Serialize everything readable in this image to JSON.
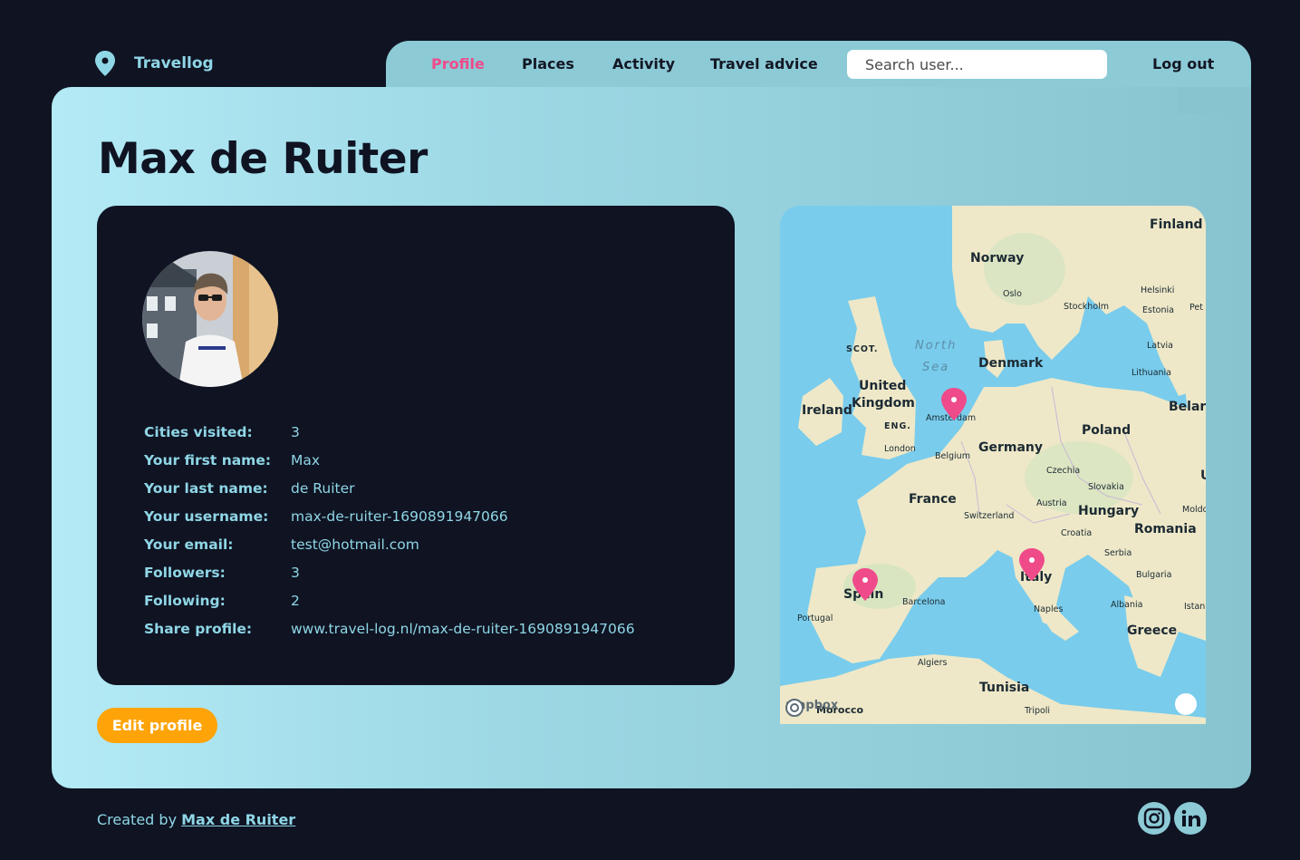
{
  "brand": {
    "name": "Travellog",
    "icon": "map-pin-icon"
  },
  "nav": {
    "items": [
      {
        "label": "Profile",
        "active": true
      },
      {
        "label": "Places",
        "active": false
      },
      {
        "label": "Activity",
        "active": false
      },
      {
        "label": "Travel advice",
        "active": false
      }
    ],
    "search_placeholder": "Search user...",
    "logout": "Log out"
  },
  "profile": {
    "name": "Max de Ruiter",
    "fields": [
      {
        "label": "Cities visited:",
        "value": "3"
      },
      {
        "label": "Your first name:",
        "value": "Max"
      },
      {
        "label": "Your last name:",
        "value": "de Ruiter"
      },
      {
        "label": "Your username:",
        "value": "max-de-ruiter-1690891947066"
      },
      {
        "label": "Your email:",
        "value": "test@hotmail.com"
      },
      {
        "label": "Followers:",
        "value": "3"
      },
      {
        "label": "Following:",
        "value": "2"
      },
      {
        "label": "Share profile:",
        "value": "www.travel-log.nl/max-de-ruiter-1690891947066"
      }
    ],
    "edit_button": "Edit profile"
  },
  "map": {
    "labels": {
      "finland": "Finland",
      "norway": "Norway",
      "oslo": "Oslo",
      "stockholm": "Stockholm",
      "helsinki": "Helsinki",
      "estonia": "Estonia",
      "pet": "Pet",
      "latvia": "Latvia",
      "lithuania": "Lithuania",
      "belarus": "Belaru",
      "scot": "SCOT.",
      "north": "North",
      "sea": "Sea",
      "denmark": "Denmark",
      "united": "United",
      "kingdom": "Kingdom",
      "ireland": "Ireland",
      "eng": "ENG.",
      "amsterdam": "Amsterdam",
      "london": "London",
      "belgium": "Belgium",
      "germany": "Germany",
      "poland": "Poland",
      "czechia": "Czechia",
      "slovakia": "Slovakia",
      "u": "U",
      "france": "France",
      "austria": "Austria",
      "switzerland": "Switzerland",
      "hungary": "Hungary",
      "moldo": "Moldo",
      "croatia": "Croatia",
      "romania": "Romania",
      "serbia": "Serbia",
      "italy": "Italy",
      "spain": "Spain",
      "bulgaria": "Bulgaria",
      "barcelona": "Barcelona",
      "portugal": "Portugal",
      "naples": "Naples",
      "albania": "Albania",
      "istan": "Istan",
      "greece": "Greece",
      "algiers": "Algiers",
      "tunisia": "Tunisia",
      "morocco": "Morocco",
      "tripoli": "Tripoli"
    },
    "attribution": "mapbox",
    "marker_color": "#ef4b8a",
    "markers": [
      "Amsterdam",
      "Italy",
      "Spain"
    ]
  },
  "footer": {
    "prefix": "Created by ",
    "author": "Max de Ruiter",
    "social": [
      "instagram-icon",
      "linkedin-icon"
    ]
  },
  "colors": {
    "background": "#0f1322",
    "accent": "#8fd6e6",
    "active_nav": "#ef4b8a",
    "button": "#fea408"
  }
}
